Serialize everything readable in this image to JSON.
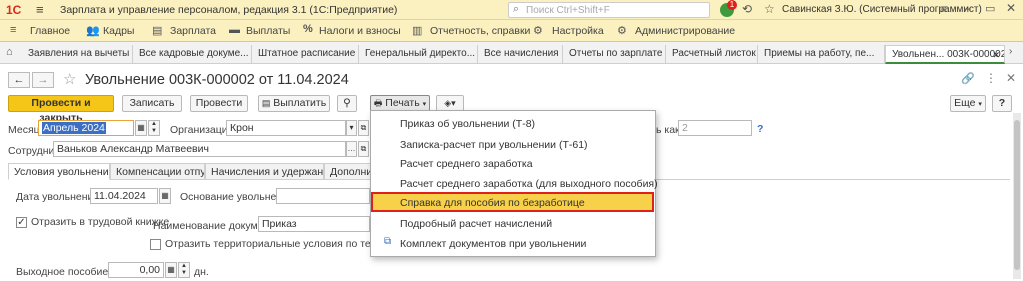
{
  "titlebar": {
    "logo": "1С",
    "app_title": "Зарплата и управление персоналом, редакция 3.1  (1С:Предприятие)",
    "search_placeholder": "Поиск Ctrl+Shift+F",
    "notification_count": "1",
    "user": "Савинская З.Ю. (Системный программист)",
    "menu_icon": "≡"
  },
  "menubar": {
    "items": [
      "Главное",
      "Кадры",
      "Зарплата",
      "Выплаты",
      "Налоги и взносы",
      "Отчетность, справки",
      "Настройка",
      "Администрирование"
    ]
  },
  "tabs": [
    "Заявления на вычеты",
    "Все кадровые докуме...",
    "Штатное расписание",
    "Генеральный директо...",
    "Все начисления",
    "Отчеты по зарплате",
    "Расчетный листок",
    "Приемы на работу, пе...",
    "Увольнен... 003К-000002"
  ],
  "document": {
    "title": "Увольнение 003К-000002 от 11.04.2024"
  },
  "toolbar": {
    "post_close": "Провести и закрыть",
    "save": "Записать",
    "post": "Провести",
    "pay": "Выплатить",
    "print": "Печать",
    "more": "Еще",
    "help": "?"
  },
  "form": {
    "month_label": "Месяц:",
    "month_value": "Апрель 2024",
    "org_label": "Организация:",
    "org_value": "Крон",
    "employee_label": "Сотрудник:",
    "employee_value": "Ваньков Александр Матвеевич",
    "right_label_suffix": "ь как:",
    "right_value": "2",
    "right_help": "?"
  },
  "subtabs": [
    "Условия увольнения",
    "Компенсации отпуска",
    "Начисления и удержания",
    "Дополните"
  ],
  "conditions": {
    "dismissal_date_label": "Дата увольнения:",
    "dismissal_date_value": "11.04.2024",
    "reason_label": "Основание увольнения:",
    "reflect_label": "Отразить в трудовой книжке",
    "doc_name_label": "Наименование документа:",
    "doc_name_value": "Приказ",
    "territory_label": "Отразить территориальные условия по территории",
    "severance_label": "Выходное пособие за:",
    "severance_value": "0,00",
    "severance_unit": "дн."
  },
  "print_menu": {
    "items": [
      "Приказ об увольнении (Т-8)",
      "Записка-расчет при увольнении (Т-61)",
      "Расчет среднего заработка",
      "Расчет среднего заработка (для выходного пособия)",
      "Справка для пособия по безработице",
      "Подробный расчет начислений",
      "Комплект документов при увольнении"
    ],
    "highlighted_index": 4
  }
}
